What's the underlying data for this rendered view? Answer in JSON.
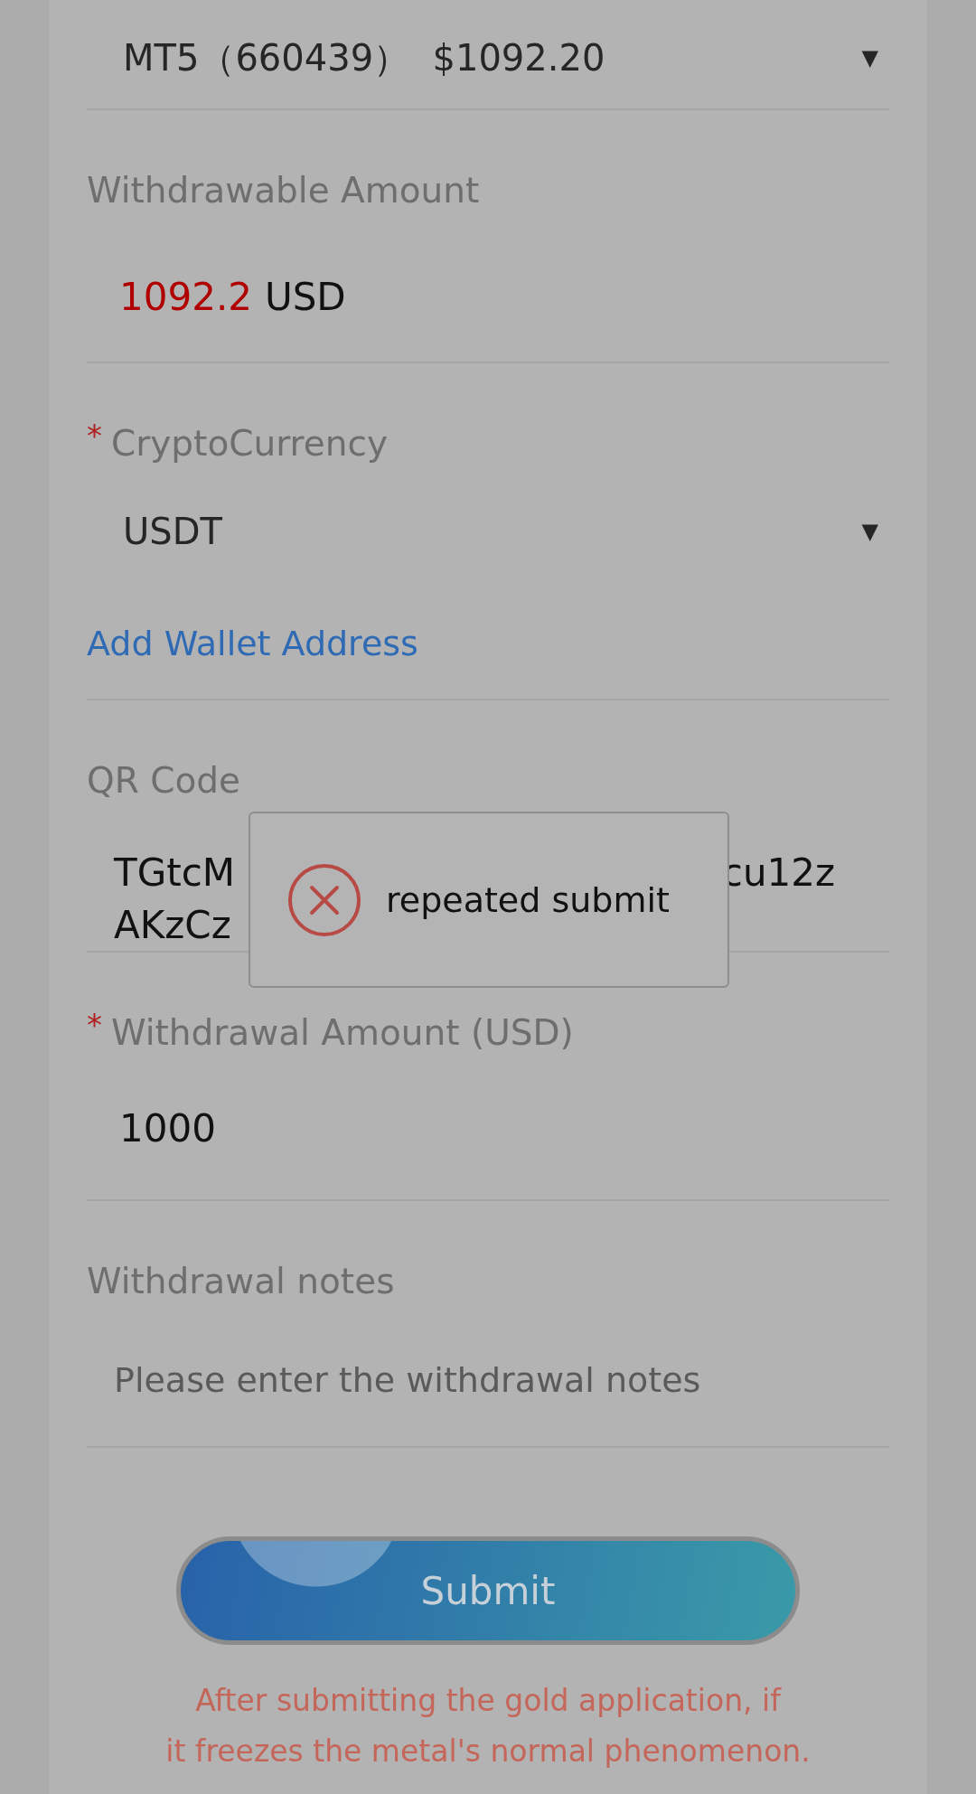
{
  "account": {
    "value": "MT5（660439）  $1092.20",
    "caret": "▼"
  },
  "withdrawable": {
    "label": "Withdrawable Amount",
    "amount": "1092.2",
    "unit": "USD"
  },
  "crypto": {
    "required_mark": "*",
    "label": "CryptoCurrency",
    "value": "USDT",
    "caret": "▼"
  },
  "add_wallet_link": "Add Wallet Address",
  "qr_code": {
    "label": "QR Code",
    "address_lines": [
      [
        "TGtcM",
        "cu12z"
      ],
      [
        "AKzCz"
      ]
    ]
  },
  "amount": {
    "required_mark": "*",
    "label": "Withdrawal Amount (USD)",
    "value": "1000"
  },
  "notes": {
    "label": "Withdrawal notes",
    "placeholder": "Please enter the withdrawal notes"
  },
  "submit": "Submit",
  "notice": [
    "After submitting the gold application, if",
    "it freezes the metal's normal phenomenon."
  ],
  "toast": {
    "message": "repeated submit"
  }
}
